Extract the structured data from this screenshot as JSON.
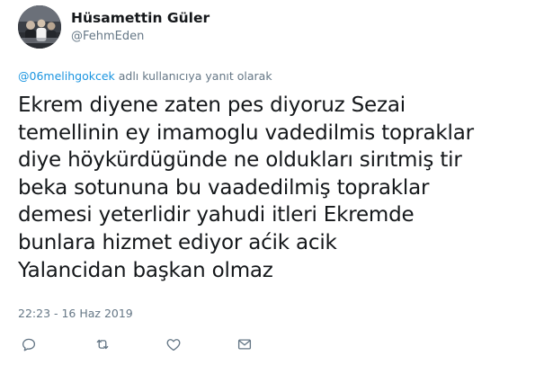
{
  "author": {
    "display_name": "Hüsamettin Güler",
    "screen_name": "@FehmEden",
    "avatar_icon": "profile-photo"
  },
  "reply": {
    "mention": "@06melihgokcek",
    "suffix": " adlı kullanıcıya yanıt olarak"
  },
  "tweet": {
    "text": "Ekrem diyene zaten pes diyoruz Sezai\ntemellinin ey imamoglu vadedilmis topraklar\ndiye höykürdügünde ne oldukları sirıtmiş tir\nbeka sotununa bu vaadedilmiş topraklar\ndemesi yeterlidir yahudi itleri Ekremde\nbunlara hizmet ediyor aćik acik\nYalancidan başkan olmaz",
    "timestamp": "22:23 - 16 Haz 2019"
  },
  "actions": [
    {
      "icon": "reply-icon"
    },
    {
      "icon": "retweet-icon"
    },
    {
      "icon": "like-icon"
    },
    {
      "icon": "direct-message-icon"
    }
  ],
  "colors": {
    "text": "#14171a",
    "secondary": "#657786",
    "link": "#1b95e0"
  }
}
